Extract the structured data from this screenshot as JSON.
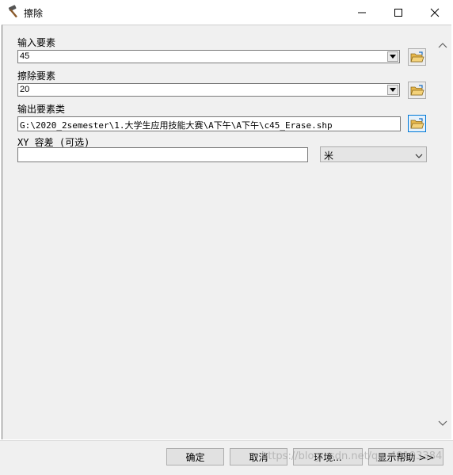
{
  "window": {
    "title": "擦除"
  },
  "fields": {
    "input_features": {
      "label": "输入要素",
      "value": "45"
    },
    "erase_features": {
      "label": "擦除要素",
      "value": "20"
    },
    "output_feature_class": {
      "label": "输出要素类",
      "value": "G:\\2020_2semester\\1.大学生应用技能大赛\\A下午\\A下午\\c45_Erase.shp"
    },
    "xy_tolerance": {
      "label": "XY 容差 (可选)",
      "value": "",
      "unit": "米"
    }
  },
  "buttons": {
    "ok": "确定",
    "cancel": "取消",
    "environments": "环境...",
    "show_help": "显示帮助 >>"
  },
  "watermark": "https://blog.csdn.net/qq_49193384",
  "icons": {
    "app": "hammer-icon",
    "browse": "open-folder-icon"
  },
  "colors": {
    "client_bg": "#f0f0f0",
    "focus_border": "#0078d7",
    "folder_yellow": "#e8b84a"
  }
}
